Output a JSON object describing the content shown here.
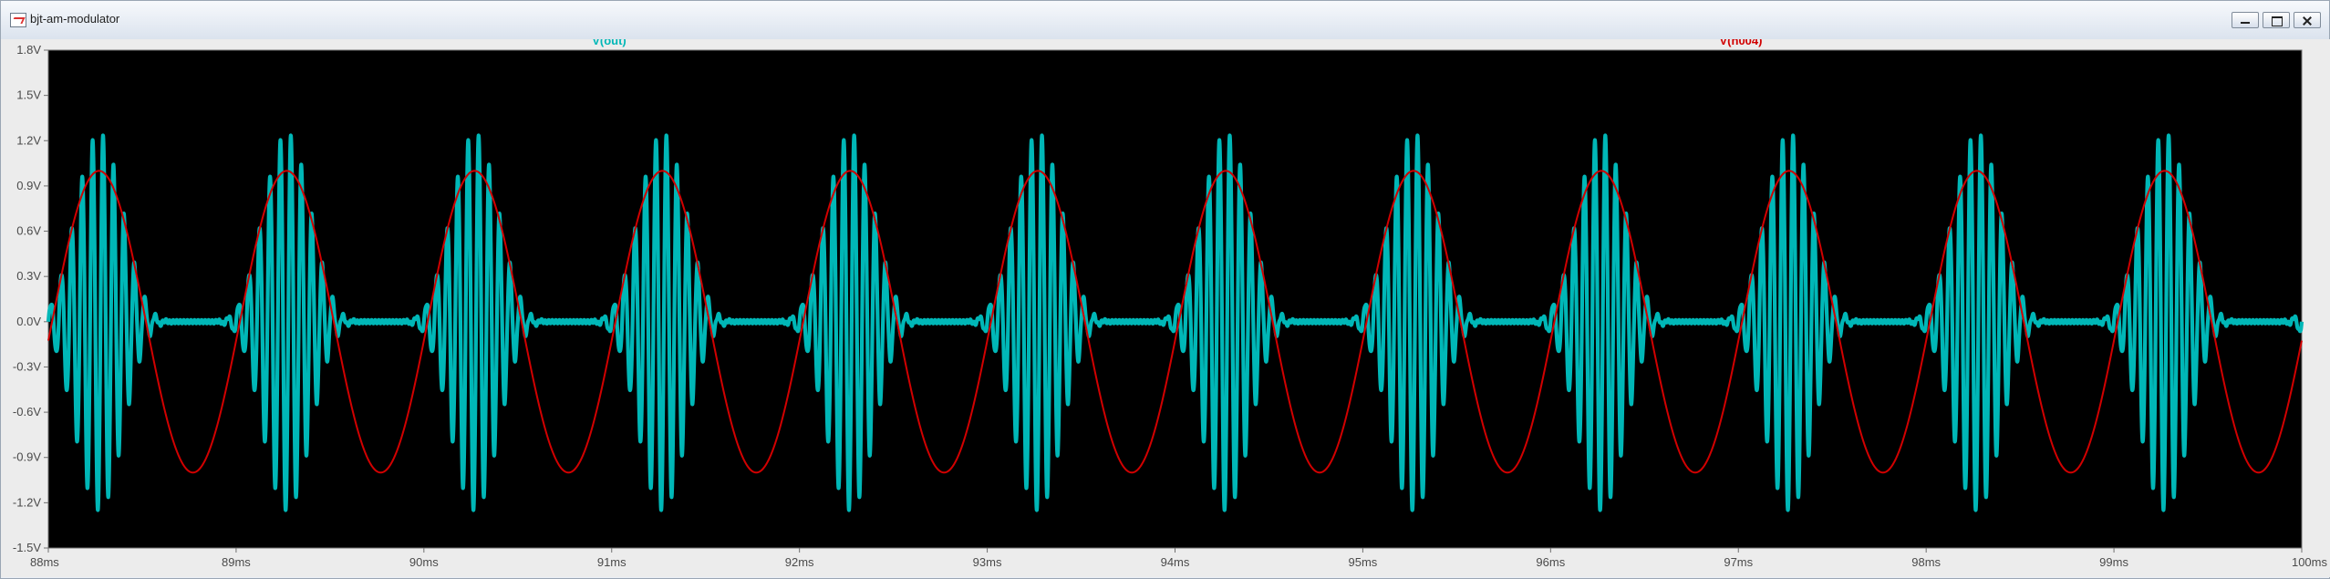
{
  "window": {
    "title": "bjt-am-modulator"
  },
  "colors": {
    "plot_background": "#000000",
    "axis": "#6f6f6f",
    "out": "#00b7b7",
    "n004": "#d10000"
  },
  "chart_data": {
    "type": "line",
    "title": "",
    "xlabel": "",
    "ylabel": "",
    "xlim": [
      88,
      100
    ],
    "ylim": [
      -1.5,
      1.8
    ],
    "grid": false,
    "legend": "top",
    "x_ticks": [
      "88ms",
      "89ms",
      "90ms",
      "91ms",
      "92ms",
      "93ms",
      "94ms",
      "95ms",
      "96ms",
      "97ms",
      "98ms",
      "99ms",
      "100ms"
    ],
    "y_ticks": [
      "1.8V",
      "1.5V",
      "1.2V",
      "0.9V",
      "0.6V",
      "0.3V",
      "0.0V",
      "-0.3V",
      "-0.6V",
      "-0.9V",
      "-1.2V",
      "-1.5V"
    ],
    "series": [
      {
        "name": "V(out)",
        "color": "#00b7b7",
        "description": "AM modulated carrier",
        "envelope_peak": 1.25,
        "envelope_trough": -1.25,
        "burst_period_ms": 1.0,
        "burst_center_first_ms": 88.27
      },
      {
        "name": "V(n004)",
        "color": "#d10000",
        "description": "sine modulating signal",
        "amplitude": 1.0,
        "frequency_khz": 1.0,
        "peak_times_ms": [
          88.27,
          89.27,
          90.27,
          91.27,
          92.27,
          93.27,
          94.27,
          95.27,
          96.27,
          97.27,
          98.27,
          99.27
        ],
        "trough_times_ms": [
          88.77,
          89.77,
          90.77,
          91.77,
          92.77,
          93.77,
          94.77,
          95.77,
          96.77,
          97.77,
          98.77,
          99.77
        ]
      }
    ]
  }
}
